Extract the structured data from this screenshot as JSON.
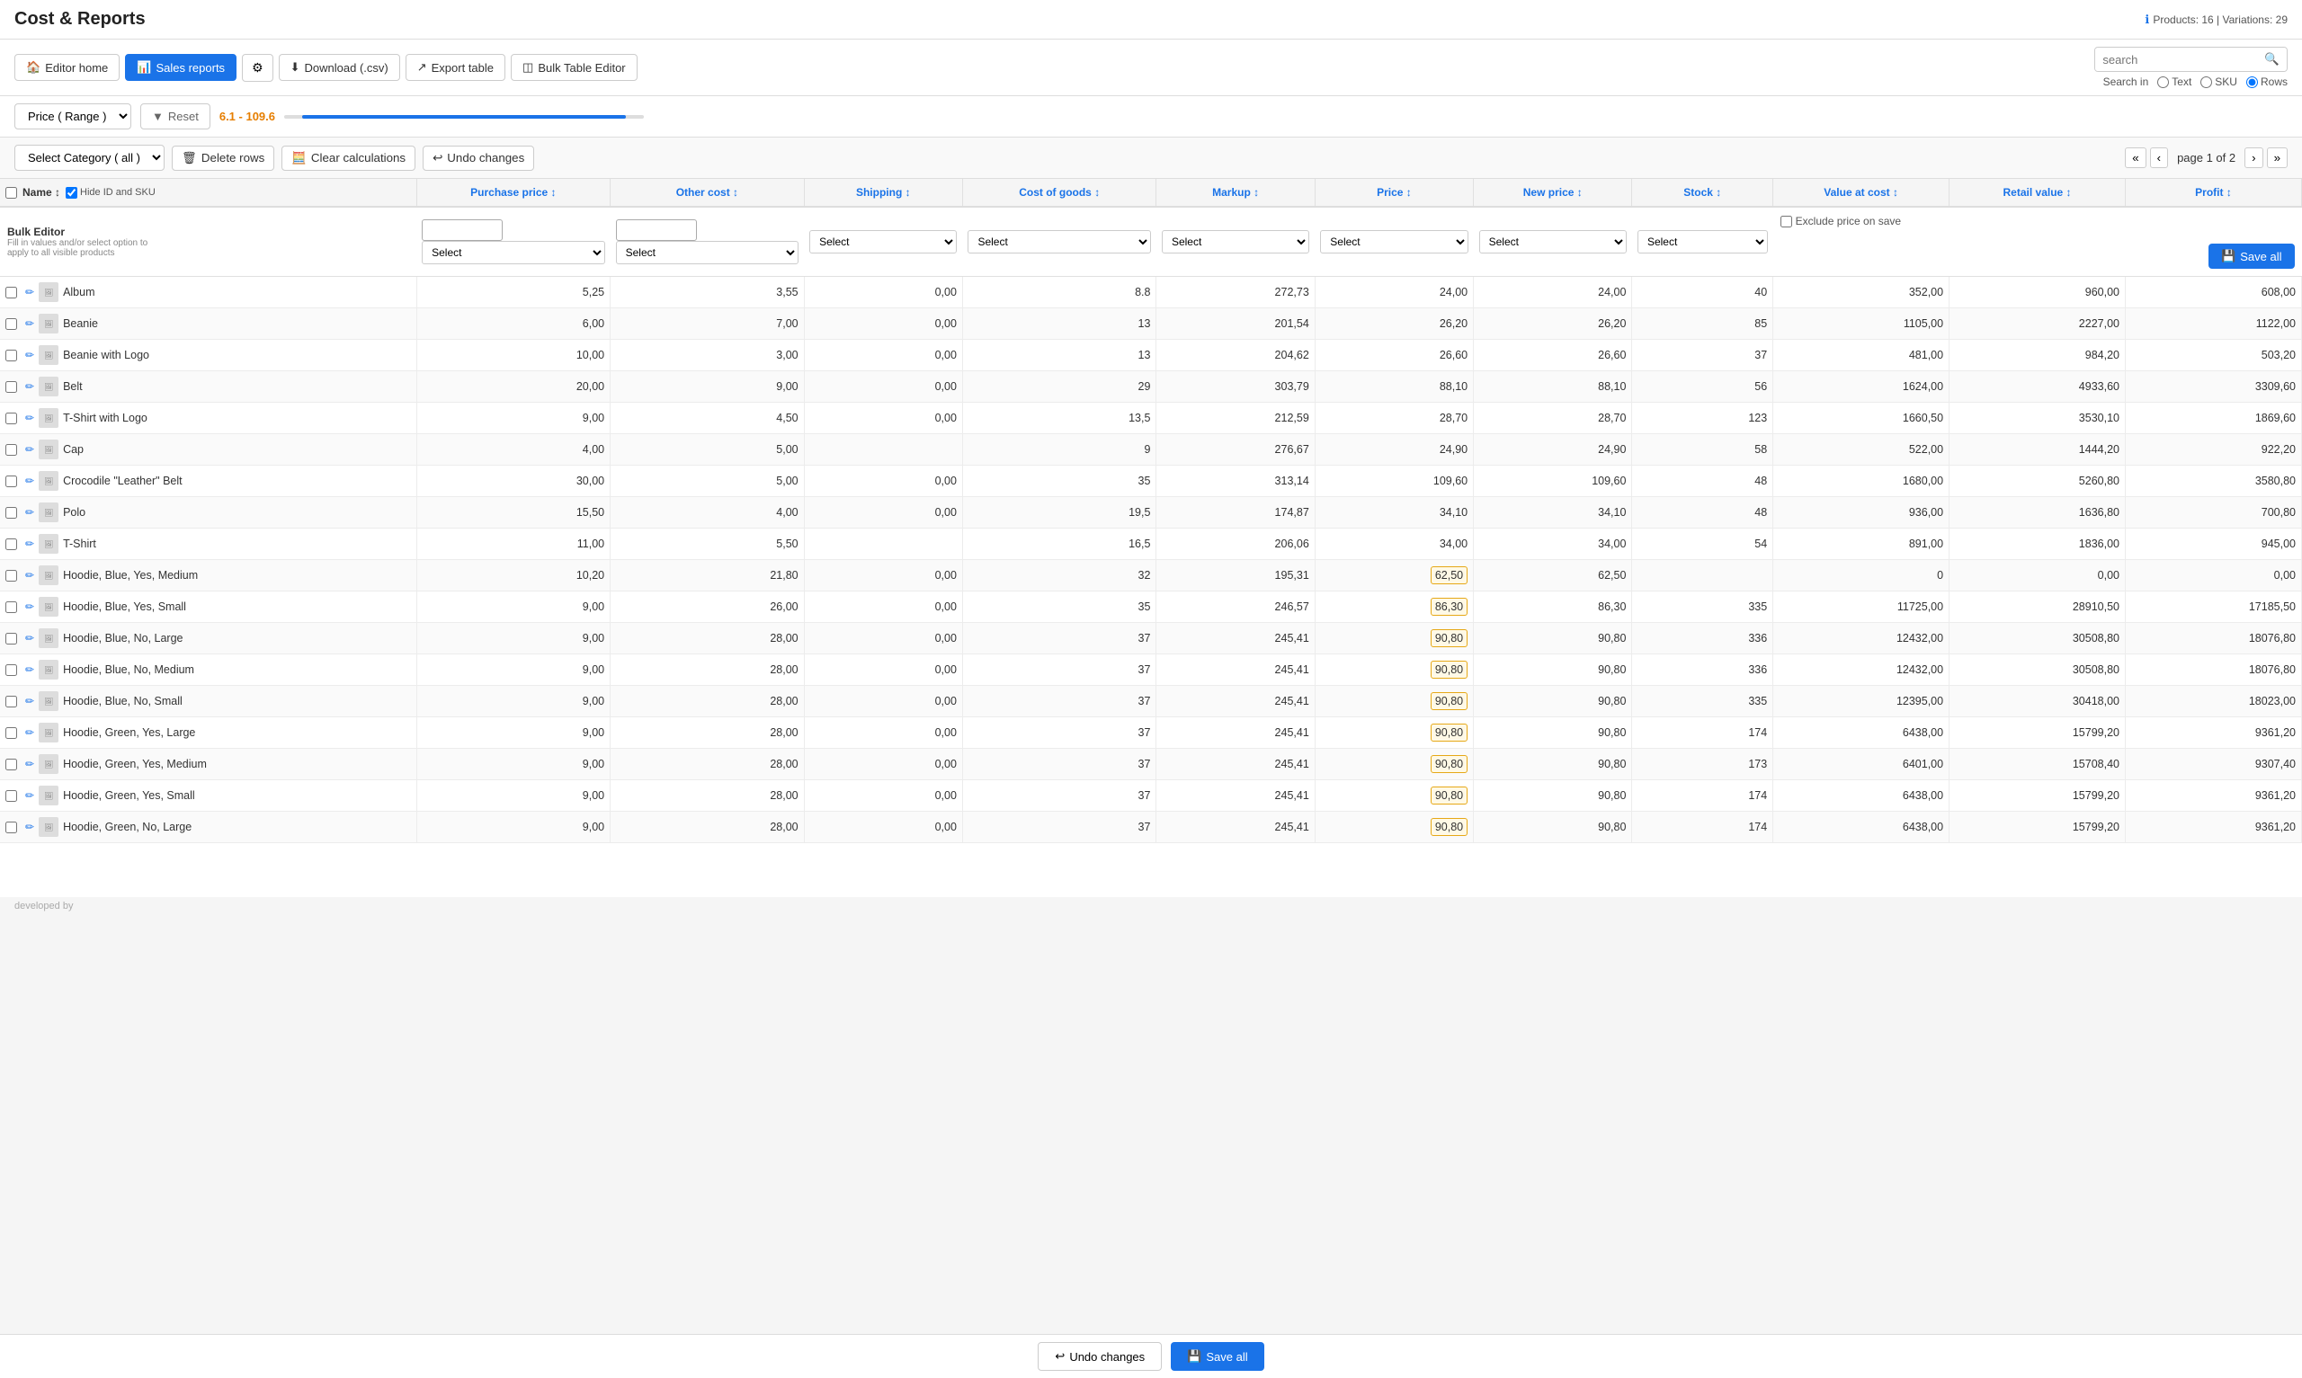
{
  "page": {
    "title": "Cost & Reports"
  },
  "header": {
    "products_info": "Products: 16 | Variations: 29",
    "search_placeholder": "search",
    "search_in_label": "Search in",
    "search_options": [
      "Text",
      "SKU",
      "Rows"
    ],
    "search_selected": "Rows"
  },
  "navbar": {
    "editor_home": "Editor home",
    "sales_reports": "Sales reports",
    "settings_icon": "⚙",
    "download_csv": "Download (.csv)",
    "export_table": "Export table",
    "bulk_table_editor": "Bulk Table Editor"
  },
  "filter": {
    "price_label": "Price ( Range )",
    "reset_label": "Reset",
    "range_display": "6.1 - 109.6"
  },
  "actions": {
    "select_category": "Select Category ( all )",
    "delete_rows": "Delete rows",
    "clear_calculations": "Clear calculations",
    "undo_changes": "Undo changes",
    "page_label": "page 1 of 2"
  },
  "table": {
    "columns": [
      {
        "id": "name",
        "label": "Name",
        "sortable": true
      },
      {
        "id": "purchase_price",
        "label": "Purchase price",
        "sortable": true
      },
      {
        "id": "other_cost",
        "label": "Other cost",
        "sortable": true
      },
      {
        "id": "shipping",
        "label": "Shipping",
        "sortable": true
      },
      {
        "id": "cost_of_goods",
        "label": "Cost of goods",
        "sortable": true
      },
      {
        "id": "markup",
        "label": "Markup",
        "sortable": true
      },
      {
        "id": "price",
        "label": "Price",
        "sortable": true
      },
      {
        "id": "new_price",
        "label": "New price",
        "sortable": true
      },
      {
        "id": "stock",
        "label": "Stock",
        "sortable": true
      },
      {
        "id": "value_at_cost",
        "label": "Value at cost",
        "sortable": true
      },
      {
        "id": "retail_value",
        "label": "Retail value",
        "sortable": true
      },
      {
        "id": "profit",
        "label": "Profit",
        "sortable": true
      }
    ],
    "hide_id_sku": "Hide ID and SKU",
    "bulk_editor": {
      "label": "Bulk Editor",
      "description": "Fill in values and/or select option to apply to all visible products",
      "select_label": "Select",
      "exclude_price_label": "Exclude price on save",
      "save_all_label": "Save all"
    },
    "rows": [
      {
        "name": "Album",
        "pp": "5,25",
        "oc": "3,55",
        "sh": "0,00",
        "cog": "8.8",
        "mu": "272,73",
        "price": "24,00",
        "new_price": "24,00",
        "stock": "40",
        "vac": "352,00",
        "rv": "960,00",
        "profit": "608,00",
        "price_highlighted": false
      },
      {
        "name": "Beanie",
        "pp": "6,00",
        "oc": "7,00",
        "sh": "0,00",
        "cog": "13",
        "mu": "201,54",
        "price": "26,20",
        "new_price": "26,20",
        "stock": "85",
        "vac": "1105,00",
        "rv": "2227,00",
        "profit": "1122,00",
        "price_highlighted": false
      },
      {
        "name": "Beanie with Logo",
        "pp": "10,00",
        "oc": "3,00",
        "sh": "0,00",
        "cog": "13",
        "mu": "204,62",
        "price": "26,60",
        "new_price": "26,60",
        "stock": "37",
        "vac": "481,00",
        "rv": "984,20",
        "profit": "503,20",
        "price_highlighted": false
      },
      {
        "name": "Belt",
        "pp": "20,00",
        "oc": "9,00",
        "sh": "0,00",
        "cog": "29",
        "mu": "303,79",
        "price": "88,10",
        "new_price": "88,10",
        "stock": "56",
        "vac": "1624,00",
        "rv": "4933,60",
        "profit": "3309,60",
        "price_highlighted": false
      },
      {
        "name": "T-Shirt with Logo",
        "pp": "9,00",
        "oc": "4,50",
        "sh": "0,00",
        "cog": "13,5",
        "mu": "212,59",
        "price": "28,70",
        "new_price": "28,70",
        "stock": "123",
        "vac": "1660,50",
        "rv": "3530,10",
        "profit": "1869,60",
        "price_highlighted": false
      },
      {
        "name": "Cap",
        "pp": "4,00",
        "oc": "5,00",
        "sh": "",
        "cog": "9",
        "mu": "276,67",
        "price": "24,90",
        "new_price": "24,90",
        "stock": "58",
        "vac": "522,00",
        "rv": "1444,20",
        "profit": "922,20",
        "price_highlighted": false
      },
      {
        "name": "Crocodile \"Leather\" Belt",
        "pp": "30,00",
        "oc": "5,00",
        "sh": "0,00",
        "cog": "35",
        "mu": "313,14",
        "price": "109,60",
        "new_price": "109,60",
        "stock": "48",
        "vac": "1680,00",
        "rv": "5260,80",
        "profit": "3580,80",
        "price_highlighted": false
      },
      {
        "name": "Polo",
        "pp": "15,50",
        "oc": "4,00",
        "sh": "0,00",
        "cog": "19,5",
        "mu": "174,87",
        "price": "34,10",
        "new_price": "34,10",
        "stock": "48",
        "vac": "936,00",
        "rv": "1636,80",
        "profit": "700,80",
        "price_highlighted": false
      },
      {
        "name": "T-Shirt",
        "pp": "11,00",
        "oc": "5,50",
        "sh": "",
        "cog": "16,5",
        "mu": "206,06",
        "price": "34,00",
        "new_price": "34,00",
        "stock": "54",
        "vac": "891,00",
        "rv": "1836,00",
        "profit": "945,00",
        "price_highlighted": false
      },
      {
        "name": "Hoodie, Blue, Yes, Medium",
        "pp": "10,20",
        "oc": "21,80",
        "sh": "0,00",
        "cog": "32",
        "mu": "195,31",
        "price": "62,50",
        "new_price": "62,50",
        "stock": "",
        "vac": "0",
        "rv": "0,00",
        "profit": "0,00",
        "price_highlighted": true
      },
      {
        "name": "Hoodie, Blue, Yes, Small",
        "pp": "9,00",
        "oc": "26,00",
        "sh": "0,00",
        "cog": "35",
        "mu": "246,57",
        "price": "86,30",
        "new_price": "86,30",
        "stock": "335",
        "vac": "11725,00",
        "rv": "28910,50",
        "profit": "17185,50",
        "price_highlighted": true
      },
      {
        "name": "Hoodie, Blue, No, Large",
        "pp": "9,00",
        "oc": "28,00",
        "sh": "0,00",
        "cog": "37",
        "mu": "245,41",
        "price": "90,80",
        "new_price": "90,80",
        "stock": "336",
        "vac": "12432,00",
        "rv": "30508,80",
        "profit": "18076,80",
        "price_highlighted": true
      },
      {
        "name": "Hoodie, Blue, No, Medium",
        "pp": "9,00",
        "oc": "28,00",
        "sh": "0,00",
        "cog": "37",
        "mu": "245,41",
        "price": "90,80",
        "new_price": "90,80",
        "stock": "336",
        "vac": "12432,00",
        "rv": "30508,80",
        "profit": "18076,80",
        "price_highlighted": true
      },
      {
        "name": "Hoodie, Blue, No, Small",
        "pp": "9,00",
        "oc": "28,00",
        "sh": "0,00",
        "cog": "37",
        "mu": "245,41",
        "price": "90,80",
        "new_price": "90,80",
        "stock": "335",
        "vac": "12395,00",
        "rv": "30418,00",
        "profit": "18023,00",
        "price_highlighted": true
      },
      {
        "name": "Hoodie, Green, Yes, Large",
        "pp": "9,00",
        "oc": "28,00",
        "sh": "0,00",
        "cog": "37",
        "mu": "245,41",
        "price": "90,80",
        "new_price": "90,80",
        "stock": "174",
        "vac": "6438,00",
        "rv": "15799,20",
        "profit": "9361,20",
        "price_highlighted": true
      },
      {
        "name": "Hoodie, Green, Yes, Medium",
        "pp": "9,00",
        "oc": "28,00",
        "sh": "0,00",
        "cog": "37",
        "mu": "245,41",
        "price": "90,80",
        "new_price": "90,80",
        "stock": "173",
        "vac": "6401,00",
        "rv": "15708,40",
        "profit": "9307,40",
        "price_highlighted": true
      },
      {
        "name": "Hoodie, Green, Yes, Small",
        "pp": "9,00",
        "oc": "28,00",
        "sh": "0,00",
        "cog": "37",
        "mu": "245,41",
        "price": "90,80",
        "new_price": "90,80",
        "stock": "174",
        "vac": "6438,00",
        "rv": "15799,20",
        "profit": "9361,20",
        "price_highlighted": true
      },
      {
        "name": "Hoodie, Green, No, Large",
        "pp": "9,00",
        "oc": "28,00",
        "sh": "0,00",
        "cog": "37",
        "mu": "245,41",
        "price": "90,80",
        "new_price": "90,80",
        "stock": "174",
        "vac": "6438,00",
        "rv": "15799,20",
        "profit": "9361,20",
        "price_highlighted": true
      }
    ]
  },
  "bottom_bar": {
    "undo_label": "Undo changes",
    "save_label": "Save all"
  },
  "footer": {
    "developed_by": "developed by"
  }
}
